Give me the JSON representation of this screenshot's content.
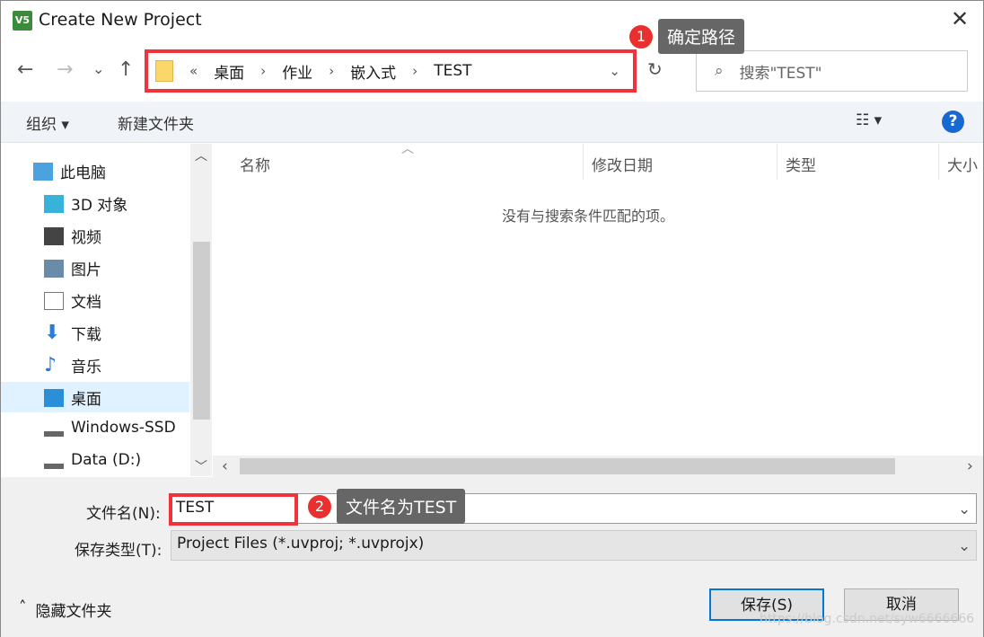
{
  "window": {
    "title": "Create New Project",
    "app_icon": "uvision-icon",
    "close": "✕"
  },
  "nav": {
    "back": "←",
    "forward": "→",
    "recent": "⌄",
    "up": "↑",
    "refresh": "↻"
  },
  "address": {
    "overflow": "«",
    "crumbs": [
      "桌面",
      "作业",
      "嵌入式",
      "TEST"
    ],
    "dropdown": "⌄"
  },
  "search": {
    "placeholder": "搜索\"TEST\""
  },
  "toolbar": {
    "organize": "组织 ▾",
    "new_folder": "新建文件夹",
    "view": "☷ ▾",
    "help": "?"
  },
  "sidebar": {
    "items": [
      {
        "label": "此电脑",
        "icon": "computer-icon"
      },
      {
        "label": "3D 对象",
        "icon": "cube-icon"
      },
      {
        "label": "视频",
        "icon": "video-icon"
      },
      {
        "label": "图片",
        "icon": "picture-icon"
      },
      {
        "label": "文档",
        "icon": "document-icon"
      },
      {
        "label": "下载",
        "icon": "download-icon"
      },
      {
        "label": "音乐",
        "icon": "music-icon"
      },
      {
        "label": "桌面",
        "icon": "desktop-icon",
        "selected": true
      },
      {
        "label": "Windows-SSD",
        "icon": "drive-icon"
      },
      {
        "label": "Data (D:)",
        "icon": "drive-icon"
      }
    ]
  },
  "columns": [
    "名称",
    "修改日期",
    "类型",
    "大小"
  ],
  "empty_message": "没有与搜索条件匹配的项。",
  "form": {
    "filename_label": "文件名(N):",
    "filename_value": "TEST",
    "filetype_label": "保存类型(T):",
    "filetype_value": "Project Files (*.uvproj; *.uvprojx)"
  },
  "hide_folders": "隐藏文件夹",
  "buttons": {
    "save": "保存(S)",
    "cancel": "取消"
  },
  "annotations": [
    {
      "number": "1",
      "text": "确定路径"
    },
    {
      "number": "2",
      "text": "文件名为TEST"
    }
  ],
  "watermark": "https://blog.csdn.net/syw6666666",
  "colors": {
    "highlight": "#f0333a",
    "accent": "#0078d7"
  }
}
